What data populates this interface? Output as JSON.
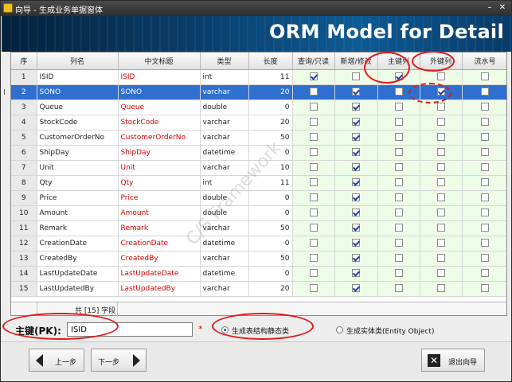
{
  "window": {
    "title": "向导 - 生成业务单据窗体"
  },
  "banner": {
    "title": "ORM Model for Detail"
  },
  "grid": {
    "columns": [
      "序",
      "列名",
      "中文标题",
      "类型",
      "长度",
      "查询/只读",
      "新增/修改",
      "主键列",
      "外键列",
      "流水号"
    ],
    "rows": [
      {
        "n": "1",
        "name": "ISID",
        "title": "ISID",
        "type": "int",
        "len": "11",
        "query": true,
        "edit": false,
        "pk": true,
        "fk": false,
        "serial": false
      },
      {
        "n": "2",
        "name": "SONO",
        "title": "SONO",
        "type": "varchar",
        "len": "20",
        "query": false,
        "edit": true,
        "pk": false,
        "fk": true,
        "serial": false
      },
      {
        "n": "3",
        "name": "Queue",
        "title": "Queue",
        "type": "double",
        "len": "0",
        "query": false,
        "edit": true,
        "pk": false,
        "fk": false,
        "serial": false
      },
      {
        "n": "4",
        "name": "StockCode",
        "title": "StockCode",
        "type": "varchar",
        "len": "20",
        "query": false,
        "edit": true,
        "pk": false,
        "fk": false,
        "serial": false
      },
      {
        "n": "5",
        "name": "CustomerOrderNo",
        "title": "CustomerOrderNo",
        "type": "varchar",
        "len": "50",
        "query": false,
        "edit": true,
        "pk": false,
        "fk": false,
        "serial": false
      },
      {
        "n": "6",
        "name": "ShipDay",
        "title": "ShipDay",
        "type": "datetime",
        "len": "0",
        "query": false,
        "edit": true,
        "pk": false,
        "fk": false,
        "serial": false
      },
      {
        "n": "7",
        "name": "Unit",
        "title": "Unit",
        "type": "varchar",
        "len": "10",
        "query": false,
        "edit": true,
        "pk": false,
        "fk": false,
        "serial": false
      },
      {
        "n": "8",
        "name": "Qty",
        "title": "Qty",
        "type": "int",
        "len": "11",
        "query": false,
        "edit": true,
        "pk": false,
        "fk": false,
        "serial": false
      },
      {
        "n": "9",
        "name": "Price",
        "title": "Price",
        "type": "double",
        "len": "0",
        "query": false,
        "edit": true,
        "pk": false,
        "fk": false,
        "serial": false
      },
      {
        "n": "10",
        "name": "Amount",
        "title": "Amount",
        "type": "double",
        "len": "0",
        "query": false,
        "edit": true,
        "pk": false,
        "fk": false,
        "serial": false
      },
      {
        "n": "11",
        "name": "Remark",
        "title": "Remark",
        "type": "varchar",
        "len": "50",
        "query": false,
        "edit": true,
        "pk": false,
        "fk": false,
        "serial": false
      },
      {
        "n": "12",
        "name": "CreationDate",
        "title": "CreationDate",
        "type": "datetime",
        "len": "0",
        "query": false,
        "edit": true,
        "pk": false,
        "fk": false,
        "serial": false
      },
      {
        "n": "13",
        "name": "CreatedBy",
        "title": "CreatedBy",
        "type": "varchar",
        "len": "50",
        "query": false,
        "edit": true,
        "pk": false,
        "fk": false,
        "serial": false
      },
      {
        "n": "14",
        "name": "LastUpdateDate",
        "title": "LastUpdateDate",
        "type": "datetime",
        "len": "0",
        "query": false,
        "edit": true,
        "pk": false,
        "fk": false,
        "serial": false
      },
      {
        "n": "15",
        "name": "LastUpdatedBy",
        "title": "LastUpdatedBy",
        "type": "varchar",
        "len": "20",
        "query": false,
        "edit": true,
        "pk": false,
        "fk": false,
        "serial": false
      }
    ],
    "selected_row": "2",
    "footer_count": "共 [15] 字段",
    "row_marker": "I"
  },
  "form": {
    "pk_label": "主键(PK):",
    "pk_value": "ISID",
    "required_mark": "*",
    "radio_static": "生成表结构静态类",
    "radio_entity": "生成实体类(Entity Object)",
    "radio_selected": "static"
  },
  "buttons": {
    "prev": "上一步",
    "next": "下一步",
    "exit": "退出向导"
  },
  "watermark": "C/S Framework",
  "colors": {
    "accent": "#2f6fcf",
    "annotation": "#e01a1a",
    "title_text": "#d40000",
    "checkbox_bg": "#eefbe6"
  }
}
